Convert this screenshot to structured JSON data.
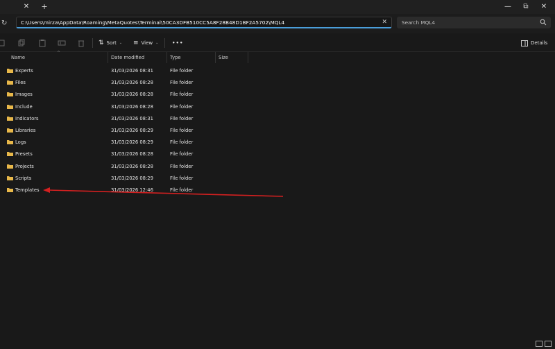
{
  "titlebar": {
    "tab_close": "✕",
    "tab_add": "+",
    "minimize": "—",
    "maximize": "⧉",
    "close": "✕"
  },
  "address": {
    "path": "C:\\Users\\mirza\\AppData\\Roaming\\MetaQuotes\\Terminal\\50CA3DFB510CC5A8F28B48D1BF2A5702\\MQL4",
    "clear": "✕"
  },
  "search": {
    "placeholder": "Search MQL4"
  },
  "toolbar": {
    "sort_label": "Sort",
    "view_label": "View",
    "more_label": "•••",
    "details_label": "Details"
  },
  "columns": {
    "name": "Name",
    "date": "Date modified",
    "type": "Type",
    "size": "Size"
  },
  "files": [
    {
      "name": "Experts",
      "date": "31/03/2026 08:31",
      "type": "File folder"
    },
    {
      "name": "Files",
      "date": "31/03/2026 08:28",
      "type": "File folder"
    },
    {
      "name": "Images",
      "date": "31/03/2026 08:28",
      "type": "File folder"
    },
    {
      "name": "Include",
      "date": "31/03/2026 08:28",
      "type": "File folder"
    },
    {
      "name": "Indicators",
      "date": "31/03/2026 08:31",
      "type": "File folder"
    },
    {
      "name": "Libraries",
      "date": "31/03/2026 08:29",
      "type": "File folder"
    },
    {
      "name": "Logs",
      "date": "31/03/2026 08:29",
      "type": "File folder"
    },
    {
      "name": "Presets",
      "date": "31/03/2026 08:28",
      "type": "File folder"
    },
    {
      "name": "Projects",
      "date": "31/03/2026 08:28",
      "type": "File folder"
    },
    {
      "name": "Scripts",
      "date": "31/03/2026 08:29",
      "type": "File folder"
    },
    {
      "name": "Templates",
      "date": "31/03/2026 12:46",
      "type": "File folder"
    }
  ],
  "colors": {
    "background": "#191919",
    "accent": "#4a9eda",
    "folder": "#e8b84a",
    "annotation_arrow": "#d42020"
  }
}
